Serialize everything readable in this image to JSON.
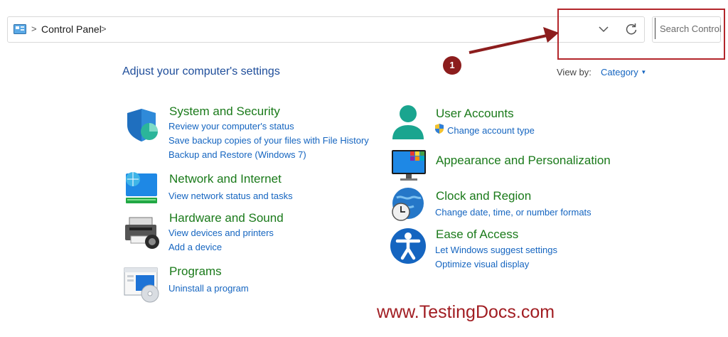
{
  "address_bar": {
    "breadcrumb": "Control Panel",
    "separator": ">"
  },
  "search": {
    "placeholder": "Search Control"
  },
  "callout": {
    "number": "1"
  },
  "main": {
    "heading": "Adjust your computer's settings",
    "view_by_label": "View by:",
    "view_by_value": "Category"
  },
  "categories": [
    {
      "title": "System and Security",
      "icon": "shield-icon",
      "links": [
        "Review your computer's status",
        "Save backup copies of your files with File History",
        "Backup and Restore (Windows 7)"
      ]
    },
    {
      "title": "Network and Internet",
      "icon": "network-globe-icon",
      "links": [
        "View network status and tasks"
      ]
    },
    {
      "title": "Hardware and Sound",
      "icon": "printer-icon",
      "links": [
        "View devices and printers",
        "Add a device"
      ]
    },
    {
      "title": "Programs",
      "icon": "programs-disc-icon",
      "links": [
        "Uninstall a program"
      ]
    },
    {
      "title": "User Accounts",
      "icon": "user-icon",
      "links": [
        "Change account type"
      ]
    },
    {
      "title": "Appearance and Personalization",
      "icon": "monitor-icon",
      "links": []
    },
    {
      "title": "Clock and Region",
      "icon": "clock-globe-icon",
      "links": [
        "Change date, time, or number formats"
      ]
    },
    {
      "title": "Ease of Access",
      "icon": "accessibility-icon",
      "links": [
        "Let Windows suggest settings",
        "Optimize visual display"
      ]
    }
  ],
  "watermark": "www.TestingDocs.com",
  "colors": {
    "category_title": "#1a7a1a",
    "link": "#1565c0",
    "heading": "#1e4d9a",
    "highlight": "#b3262b"
  }
}
